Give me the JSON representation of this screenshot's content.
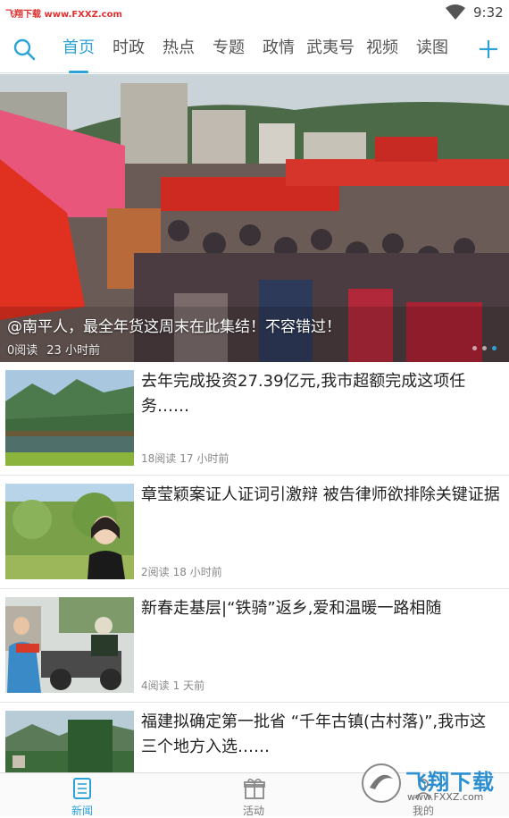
{
  "status_bar": {
    "watermark": "飞翔下载 www.FXXZ.com",
    "time": "9:32"
  },
  "tabs": [
    {
      "label": "首页",
      "active": true
    },
    {
      "label": "时政"
    },
    {
      "label": "热点"
    },
    {
      "label": "专题"
    },
    {
      "label": "政情"
    },
    {
      "label": "武夷号"
    },
    {
      "label": "视频"
    },
    {
      "label": "读图"
    }
  ],
  "accent_color": "#2ba3d9",
  "banner": {
    "caption": "@南平人，最全年货这周末在此集结！不容错过！",
    "reads": "0阅读",
    "time": "23 小时前"
  },
  "news": [
    {
      "title": "去年完成投资27.39亿元,我市超额完成这项任务……",
      "reads": "18阅读",
      "time": "17 小时前"
    },
    {
      "title": "章莹颖案证人证词引激辩 被告律师欲排除关键证据",
      "reads": "2阅读",
      "time": "18 小时前"
    },
    {
      "title": "新春走基层|“铁骑”返乡,爱和温暖一路相随",
      "reads": "4阅读",
      "time": "1 天前"
    },
    {
      "title": "福建拟确定第一批省 “千年古镇(古村落)”,我市这三个地方入选……",
      "reads": "",
      "time": ""
    }
  ],
  "bottom_nav": [
    {
      "label": "新闻",
      "icon": "newspaper-icon",
      "active": true
    },
    {
      "label": "活动",
      "icon": "gift-icon"
    },
    {
      "label": "我的",
      "icon": "user-icon"
    }
  ],
  "watermark_logo": {
    "text": "飞翔下载",
    "url": "www.FXXZ.com"
  }
}
